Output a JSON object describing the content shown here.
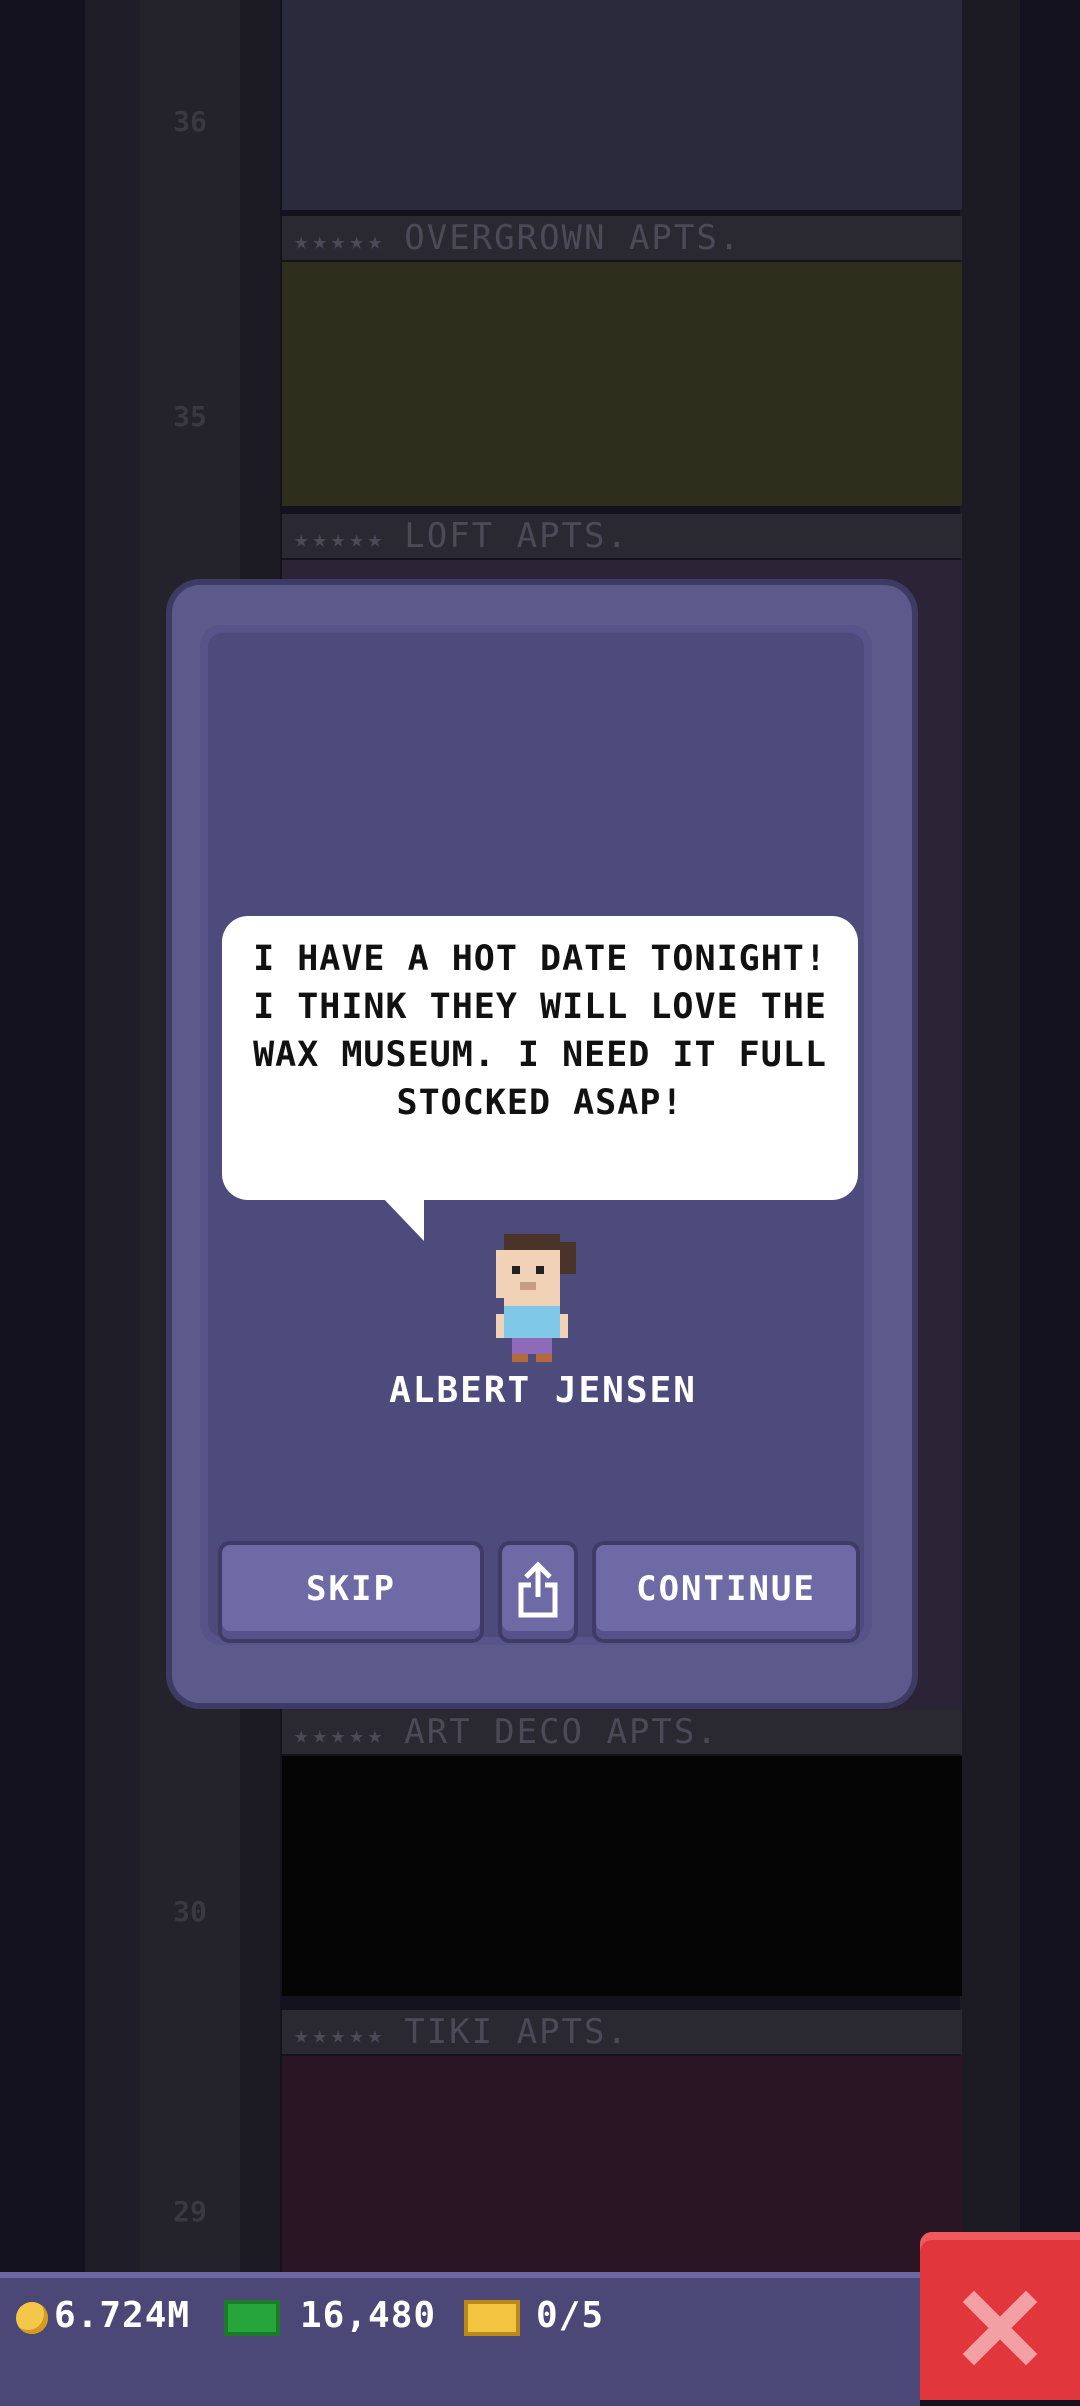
{
  "tower": {
    "floors": [
      {
        "label": "OVERGROWN APTS.",
        "number": "36"
      },
      {
        "label": "LOFT APTS.",
        "number": "35"
      },
      {
        "label": "ART DECO APTS.",
        "number": "30"
      },
      {
        "label": "TIKI APTS.",
        "number": "29"
      }
    ],
    "stars": "★★★★★",
    "floor_numbers_top": {
      "a": "36",
      "b": "35"
    },
    "floor_numbers_bottom": {
      "a": "30",
      "b": "29"
    }
  },
  "dialog": {
    "message": "I HAVE A HOT DATE TONIGHT! I THINK THEY WILL LOVE THE WAX MUSEUM. I NEED IT FULL STOCKED ASAP!",
    "character_name": "ALBERT JENSEN",
    "skip_label": "SKIP",
    "continue_label": "CONTINUE"
  },
  "status_bar": {
    "coins": "6.724M",
    "bux": "16,480",
    "tickets": "0/5"
  },
  "icons": {
    "share": "share-icon",
    "close": "close-icon",
    "coin": "coin-icon",
    "cash": "cash-icon",
    "ticket": "ticket-icon"
  }
}
